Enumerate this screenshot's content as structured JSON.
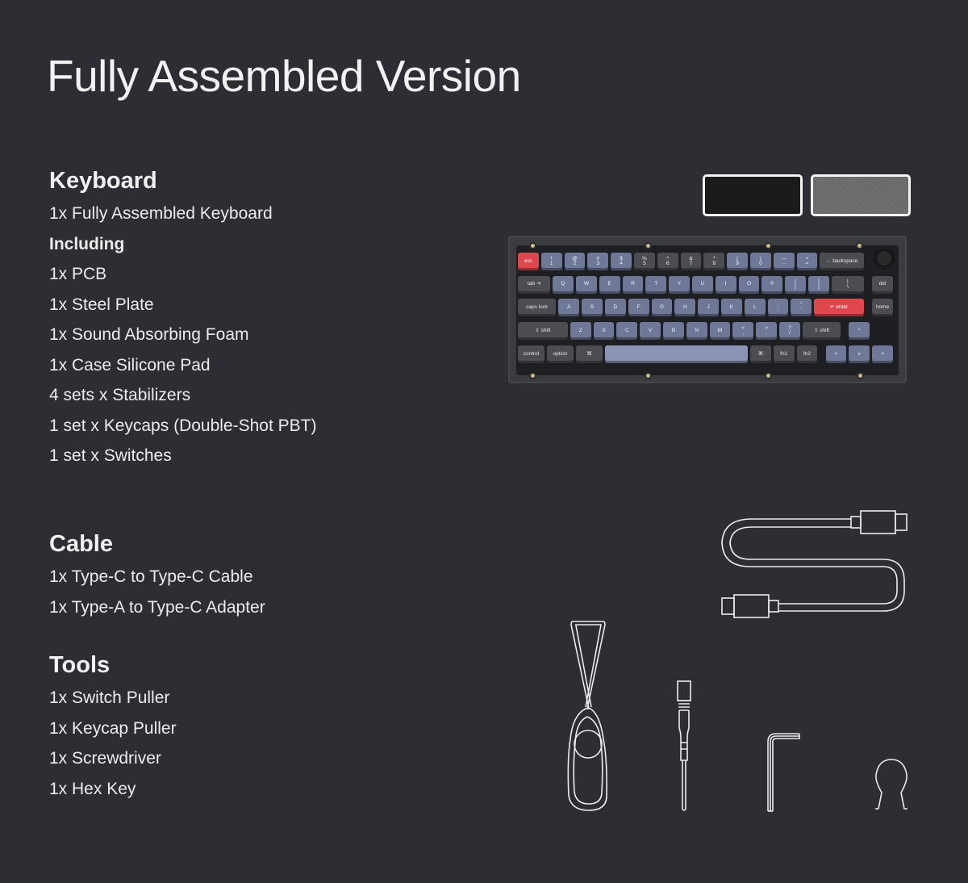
{
  "page_title": "Fully Assembled Version",
  "sections": {
    "keyboard": {
      "heading": "Keyboard",
      "items": [
        {
          "text": "1x Fully Assembled Keyboard",
          "bold": false
        },
        {
          "text": "Including",
          "bold": true
        },
        {
          "text": "1x PCB",
          "bold": false
        },
        {
          "text": "1x Steel Plate",
          "bold": false
        },
        {
          "text": "1x Sound Absorbing Foam",
          "bold": false
        },
        {
          "text": "1x Case Silicone Pad",
          "bold": false
        },
        {
          "text": "4 sets x Stabilizers",
          "bold": false
        },
        {
          "text": "1 set x Keycaps (Double-Shot PBT)",
          "bold": false
        },
        {
          "text": "1 set x Switches",
          "bold": false
        }
      ]
    },
    "cable": {
      "heading": "Cable",
      "items": [
        {
          "text": "1x Type-C to Type-C Cable",
          "bold": false
        },
        {
          "text": "1x Type-A to Type-C Adapter",
          "bold": false
        }
      ]
    },
    "tools": {
      "heading": "Tools",
      "items": [
        {
          "text": "1x Switch Puller",
          "bold": false
        },
        {
          "text": "1x Keycap Puller",
          "bold": false
        },
        {
          "text": "1x Screwdriver",
          "bold": false
        },
        {
          "text": "1x Hex Key",
          "bold": false
        }
      ]
    }
  },
  "colors": {
    "background": "#2d2e33",
    "swatch_black": "#1b1b1c",
    "swatch_gray": "#6a6a6a",
    "keycap_accent": "#e0474c",
    "keycap_alpha": "#6f7896",
    "keycap_mod": "#4c4d52"
  },
  "keyboard_rows": [
    [
      {
        "l": "esc",
        "t": "red",
        "w": 1
      },
      {
        "l": "!\n1",
        "t": "alpha",
        "w": 1
      },
      {
        "l": "@\n2",
        "t": "alpha",
        "w": 1
      },
      {
        "l": "#\n3",
        "t": "alpha",
        "w": 1
      },
      {
        "l": "$\n4",
        "t": "alpha",
        "w": 1
      },
      {
        "l": "%\n5",
        "t": "mod",
        "w": 1
      },
      {
        "l": "^\n6",
        "t": "mod",
        "w": 1
      },
      {
        "l": "&\n7",
        "t": "mod",
        "w": 1
      },
      {
        "l": "*\n8",
        "t": "mod",
        "w": 1
      },
      {
        "l": "(\n9",
        "t": "alpha",
        "w": 1
      },
      {
        "l": ")\n0",
        "t": "alpha",
        "w": 1
      },
      {
        "l": "—\n-",
        "t": "alpha",
        "w": 1
      },
      {
        "l": "+\n=",
        "t": "alpha",
        "w": 1
      },
      {
        "l": "← backspace",
        "t": "mod",
        "w": 2
      }
    ],
    [
      {
        "l": "tab ⇥",
        "t": "mod",
        "w": 1.5
      },
      {
        "l": "Q",
        "t": "alpha",
        "w": 1
      },
      {
        "l": "W",
        "t": "alpha",
        "w": 1
      },
      {
        "l": "E",
        "t": "alpha",
        "w": 1
      },
      {
        "l": "R",
        "t": "alpha",
        "w": 1
      },
      {
        "l": "T",
        "t": "alpha",
        "w": 1
      },
      {
        "l": "Y",
        "t": "alpha",
        "w": 1
      },
      {
        "l": "U",
        "t": "alpha",
        "w": 1
      },
      {
        "l": "I",
        "t": "alpha",
        "w": 1
      },
      {
        "l": "O",
        "t": "alpha",
        "w": 1
      },
      {
        "l": "P",
        "t": "alpha",
        "w": 1
      },
      {
        "l": "{\n[",
        "t": "alpha",
        "w": 1
      },
      {
        "l": "}\n]",
        "t": "alpha",
        "w": 1
      },
      {
        "l": "|\n\\",
        "t": "mod",
        "w": 1.5
      },
      {
        "l": "del",
        "t": "mod",
        "w": 1,
        "gap": 0.25
      }
    ],
    [
      {
        "l": "caps lock",
        "t": "mod",
        "w": 1.75
      },
      {
        "l": "A",
        "t": "alpha",
        "w": 1
      },
      {
        "l": "S",
        "t": "alpha",
        "w": 1
      },
      {
        "l": "D",
        "t": "alpha",
        "w": 1
      },
      {
        "l": "F",
        "t": "alpha",
        "w": 1
      },
      {
        "l": "G",
        "t": "alpha",
        "w": 1
      },
      {
        "l": "H",
        "t": "alpha",
        "w": 1
      },
      {
        "l": "J",
        "t": "alpha",
        "w": 1
      },
      {
        "l": "K",
        "t": "alpha",
        "w": 1
      },
      {
        "l": "L",
        "t": "alpha",
        "w": 1
      },
      {
        "l": ":\n;",
        "t": "alpha",
        "w": 1
      },
      {
        "l": "\"\n'",
        "t": "alpha",
        "w": 1
      },
      {
        "l": "↵ enter",
        "t": "red",
        "w": 2.25
      },
      {
        "l": "home",
        "t": "mod",
        "w": 1,
        "gap": 0.25
      }
    ],
    [
      {
        "l": "⇧ shift",
        "t": "mod",
        "w": 2.25
      },
      {
        "l": "Z",
        "t": "alpha",
        "w": 1
      },
      {
        "l": "X",
        "t": "alpha",
        "w": 1
      },
      {
        "l": "C",
        "t": "alpha",
        "w": 1
      },
      {
        "l": "V",
        "t": "alpha",
        "w": 1
      },
      {
        "l": "B",
        "t": "alpha",
        "w": 1
      },
      {
        "l": "N",
        "t": "alpha",
        "w": 1
      },
      {
        "l": "M",
        "t": "alpha",
        "w": 1
      },
      {
        "l": "<\n,",
        "t": "alpha",
        "w": 1
      },
      {
        "l": ">\n.",
        "t": "alpha",
        "w": 1
      },
      {
        "l": "?\n/",
        "t": "alpha",
        "w": 1
      },
      {
        "l": "⇧ shift",
        "t": "mod",
        "w": 1.75
      },
      {
        "l": "^",
        "t": "alpha",
        "w": 1,
        "gap": 0.25
      }
    ],
    [
      {
        "l": "control",
        "t": "mod",
        "w": 1.25
      },
      {
        "l": "option",
        "t": "mod",
        "w": 1.25
      },
      {
        "l": "⌘",
        "t": "mod",
        "w": 1.25
      },
      {
        "l": "",
        "t": "space",
        "w": 6.25
      },
      {
        "l": "⌘",
        "t": "mod",
        "w": 1
      },
      {
        "l": "fn1",
        "t": "mod",
        "w": 1
      },
      {
        "l": "fn2",
        "t": "mod",
        "w": 1
      },
      {
        "l": "<",
        "t": "alpha",
        "w": 1,
        "gap": 0.25
      },
      {
        "l": "v",
        "t": "alpha",
        "w": 1
      },
      {
        "l": ">",
        "t": "alpha",
        "w": 1
      }
    ]
  ]
}
